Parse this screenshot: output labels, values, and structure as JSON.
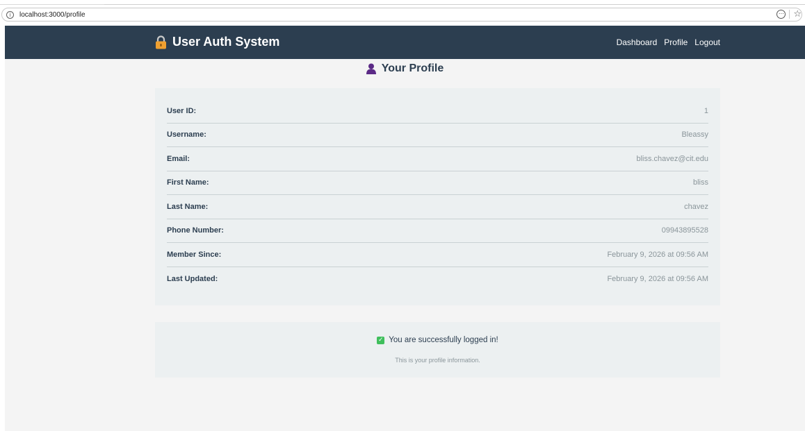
{
  "browser": {
    "url": "localhost:3000/profile",
    "info_icon": "info-icon",
    "more_icon": "more-options-icon",
    "star_icon": "bookmark-star-icon"
  },
  "navbar": {
    "brand": "User Auth System",
    "brand_icon": "lock-icon",
    "links": [
      "Dashboard",
      "Profile",
      "Logout"
    ],
    "background": "#2c3e50"
  },
  "profile": {
    "title": "Your Profile",
    "title_icon": "person-icon",
    "fields": [
      {
        "label": "User ID:",
        "value": "1"
      },
      {
        "label": "Username:",
        "value": "Bleassy"
      },
      {
        "label": "Email:",
        "value": "bliss.chavez@cit.edu"
      },
      {
        "label": "First Name:",
        "value": "bliss"
      },
      {
        "label": "Last Name:",
        "value": "chavez"
      },
      {
        "label": "Phone Number:",
        "value": "09943895528"
      },
      {
        "label": "Member Since:",
        "value": "February 9, 2026 at 09:56 AM"
      },
      {
        "label": "Last Updated:",
        "value": "February 9, 2026 at 09:56 AM"
      }
    ]
  },
  "status": {
    "message": "You are successfully logged in!",
    "note": "This is your profile information.",
    "icon": "check-icon",
    "accent": "#3fbf5c"
  }
}
